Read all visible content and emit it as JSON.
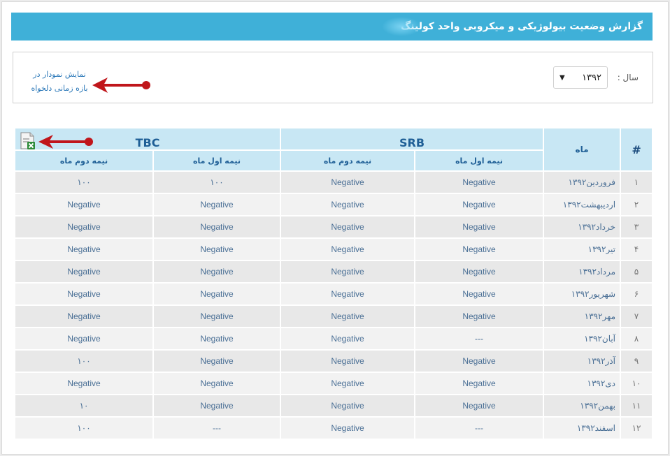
{
  "header": {
    "title": "گزارش وضعیت بیولوژیکی و میکروبی واحد کولینگ"
  },
  "filter": {
    "year_label": "سال :",
    "year_value": "۱۳۹۲",
    "chart_link_line1": "نمایش نمودار در",
    "chart_link_line2": "بازه زمانی دلخواه"
  },
  "table": {
    "headers": {
      "hash": "#",
      "month": "ماه",
      "srb": "SRB",
      "tbc": "TBC",
      "first_half": "نیمه اول ماه",
      "second_half": "نیمه دوم ماه"
    },
    "rows": [
      {
        "num": "۱",
        "month": "فروردین۱۳۹۲",
        "srb1": "Negative",
        "srb2": "Negative",
        "tbc1": "۱۰۰",
        "tbc2": "۱۰۰"
      },
      {
        "num": "۲",
        "month": "اردیبهشت۱۳۹۲",
        "srb1": "Negative",
        "srb2": "Negative",
        "tbc1": "Negative",
        "tbc2": "Negative"
      },
      {
        "num": "۳",
        "month": "خرداد۱۳۹۲",
        "srb1": "Negative",
        "srb2": "Negative",
        "tbc1": "Negative",
        "tbc2": "Negative"
      },
      {
        "num": "۴",
        "month": "تیر۱۳۹۲",
        "srb1": "Negative",
        "srb2": "Negative",
        "tbc1": "Negative",
        "tbc2": "Negative"
      },
      {
        "num": "۵",
        "month": "مرداد۱۳۹۲",
        "srb1": "Negative",
        "srb2": "Negative",
        "tbc1": "Negative",
        "tbc2": "Negative"
      },
      {
        "num": "۶",
        "month": "شهریور۱۳۹۲",
        "srb1": "Negative",
        "srb2": "Negative",
        "tbc1": "Negative",
        "tbc2": "Negative"
      },
      {
        "num": "۷",
        "month": "مهر۱۳۹۲",
        "srb1": "Negative",
        "srb2": "Negative",
        "tbc1": "Negative",
        "tbc2": "Negative"
      },
      {
        "num": "۸",
        "month": "آبان۱۳۹۲",
        "srb1": "---",
        "srb2": "Negative",
        "tbc1": "Negative",
        "tbc2": "Negative"
      },
      {
        "num": "۹",
        "month": "آذر۱۳۹۲",
        "srb1": "Negative",
        "srb2": "Negative",
        "tbc1": "Negative",
        "tbc2": "۱۰۰"
      },
      {
        "num": "۱۰",
        "month": "دی۱۳۹۲",
        "srb1": "Negative",
        "srb2": "Negative",
        "tbc1": "Negative",
        "tbc2": "Negative"
      },
      {
        "num": "۱۱",
        "month": "بهمن۱۳۹۲",
        "srb1": "Negative",
        "srb2": "Negative",
        "tbc1": "Negative",
        "tbc2": "۱۰"
      },
      {
        "num": "۱۲",
        "month": "اسفند۱۳۹۲",
        "srb1": "---",
        "srb2": "Negative",
        "tbc1": "---",
        "tbc2": "۱۰۰"
      }
    ]
  },
  "icons": {
    "export": "excel-export-icon",
    "annotation_arrow": "red-arrow-icon"
  },
  "colors": {
    "title_bar": "#3fb0d8",
    "header_cell": "#c8e7f4",
    "arrow": "#c0161b"
  }
}
